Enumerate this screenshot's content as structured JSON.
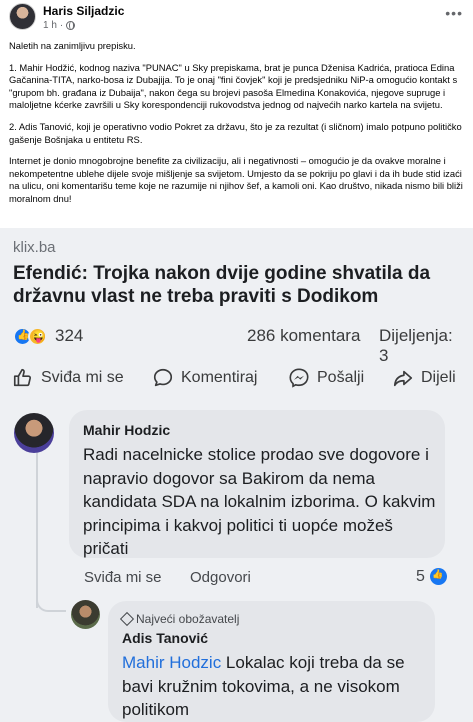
{
  "post": {
    "author": "Haris Siljadzic",
    "time": "1 h",
    "visibility_separator": "·",
    "paragraphs": [
      "Naletih na zanimljivu prepisku.",
      "1. Mahir Hodžić, kodnog naziva \"PUNAC\" u Sky prepiskama, brat je punca Dženisa Kadrića, pratioca Edina Gačanina-TITA, narko-bosa iz Dubajija. To je onaj \"fini čovjek\" koji je predsjedniku NiP-a omogućio kontakt s \"grupom bh. građana iz Dubaija\", nakon čega su brojevi pasoša Elmedina Konakovića, njegove supruge i maloljetne kćerke završili u Sky korespondenciji rukovodstva jednog od najvećih narko kartela na svijetu.",
      "2. Adis Tanović, koji je operativno vodio Pokret za državu, što je za rezultat (i sličnom) imalo  potpuno političko gašenje Bošnjaka u entitetu RS.",
      "Internet je donio mnogobrojne benefite za civilizaciju, ali i negativnosti – omogućio je da ovakve moralne i nekompetentne ublehe dijele svoje mišljenje sa svijetom. Umjesto da se pokriju po glavi i da ih bude stid izaći na ulicu, oni komentarišu teme koje ne razumije ni njihov šef, a kamoli oni. Kao društvo, nikada nismo bili bliži moralnom dnu!"
    ]
  },
  "embed": {
    "site": "klix.ba",
    "headline": "Efendić: Trojka nakon dvije godine shvatila da državnu vlast ne treba praviti s Dodikom",
    "reactions_count": "324",
    "comments_count": "286 komentara",
    "shares_count": "Dijeljenja: 3",
    "actions": {
      "like": "Sviđa mi se",
      "comment": "Komentiraj",
      "send": "Pošalji",
      "share": "Dijeli"
    },
    "comment1": {
      "author": "Mahir Hodzic",
      "text": "Radi nacelnicke stolice prodao sve dogovore i napravio dogovor sa Bakirom da nema kandidata SDA na lokalnim izborima. O kakvim principima i kakvoj politici ti uopće možeš pričati",
      "like_label": "Sviđa mi se",
      "reply_label": "Odgovori",
      "likes": "5"
    },
    "comment2": {
      "badge": "Najveći obožavatelj",
      "author": "Adis Tanović",
      "mention": "Mahir Hodzic",
      "text": " Lokalac koji treba da se bavi kružnim tokovima, a ne visokom politikom"
    }
  },
  "icons": {
    "more": "more-horizontal-icon",
    "globe": "globe-icon",
    "like": "thumbs-up-icon",
    "comment": "speech-bubble-icon",
    "send": "messenger-icon",
    "share": "share-arrow-icon",
    "fan": "diamond-icon"
  },
  "colors": {
    "mention": "#216fdb",
    "like_blue": "#1877f2",
    "bubble": "#e4e6ea",
    "embed_bg": "#eef0f3"
  }
}
